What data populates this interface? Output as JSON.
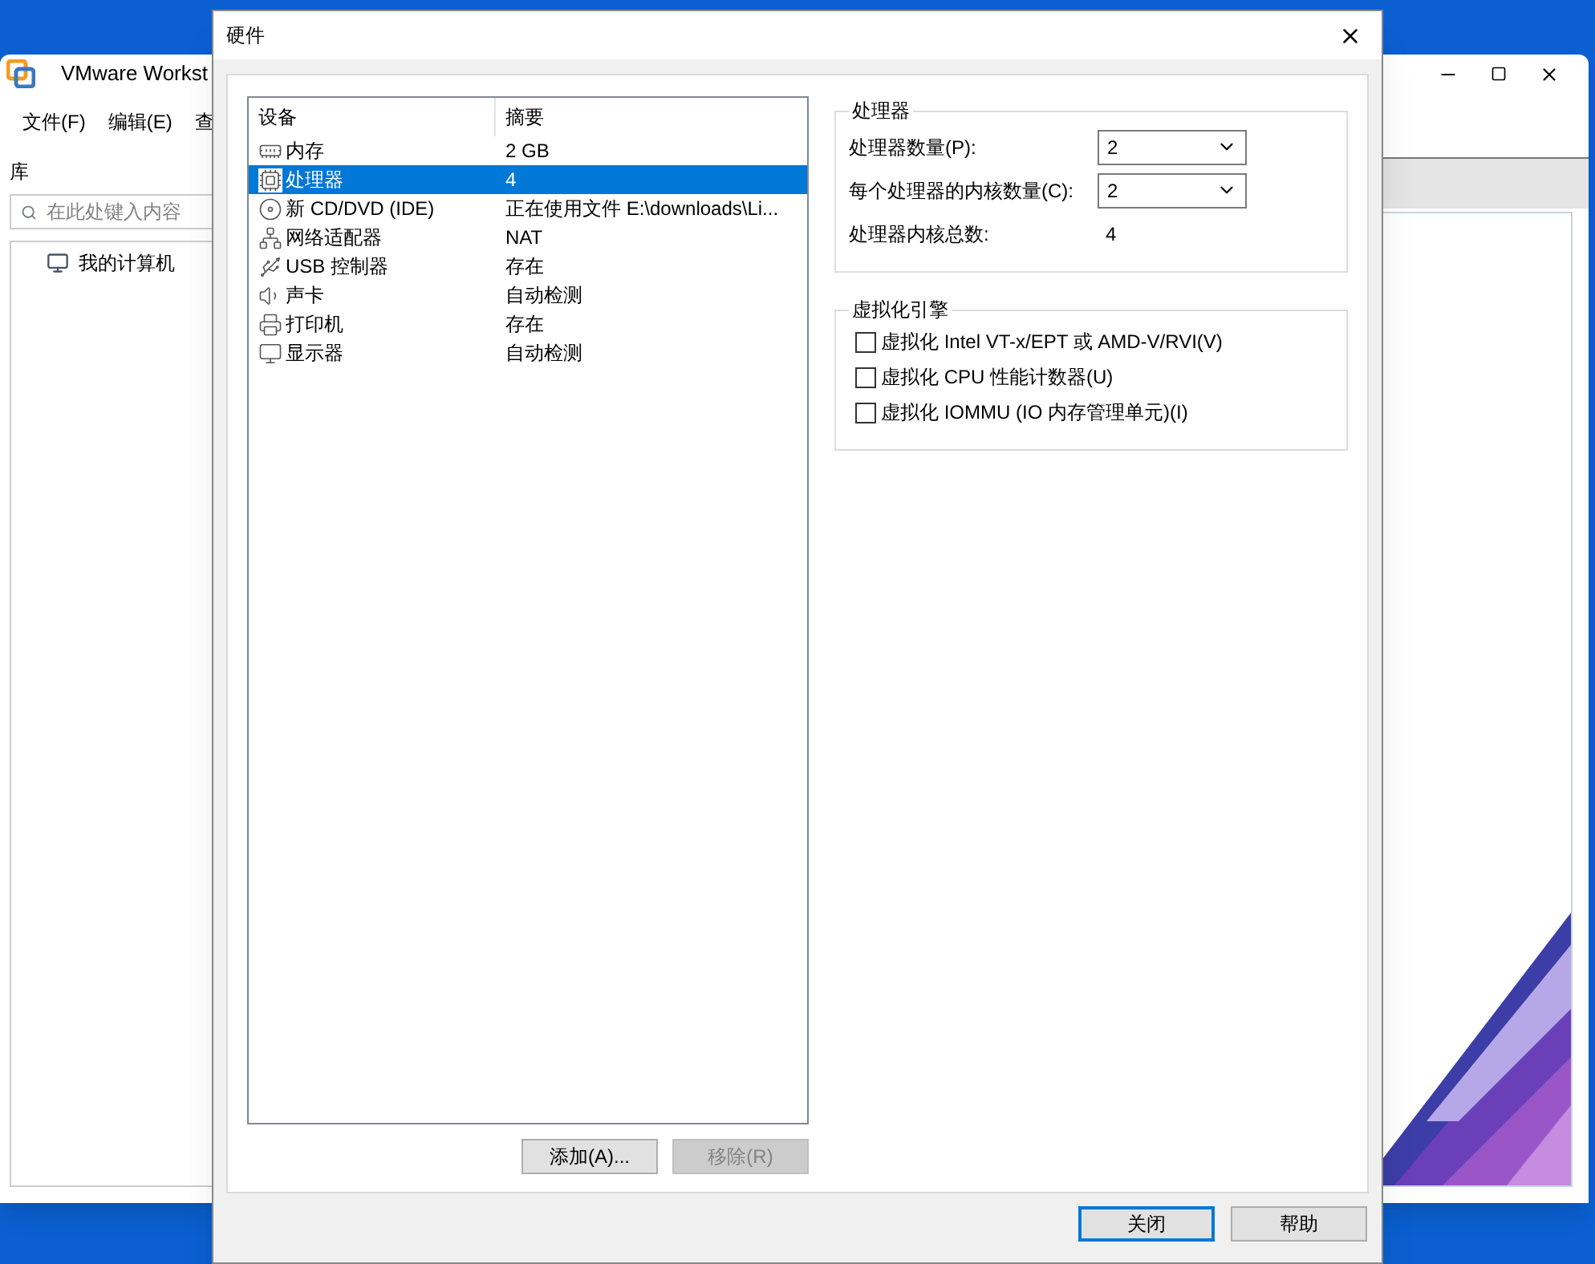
{
  "background_window": {
    "title": "VMware Workst",
    "menu": [
      "文件(F)",
      "编辑(E)",
      "查"
    ],
    "library_label": "库",
    "search": {
      "placeholder": "在此处键入内容"
    },
    "tree": [
      {
        "label": "我的计算机"
      }
    ]
  },
  "dialog": {
    "title": "硬件",
    "devices": {
      "columns": [
        "设备",
        "摘要"
      ],
      "rows": [
        {
          "kind": "memory",
          "device": "内存",
          "summary": "2 GB",
          "selected": false
        },
        {
          "kind": "processor",
          "device": "处理器",
          "summary": "4",
          "selected": true
        },
        {
          "kind": "disc",
          "device": "新 CD/DVD (IDE)",
          "summary": "正在使用文件 E:\\downloads\\Li...",
          "selected": false
        },
        {
          "kind": "network",
          "device": "网络适配器",
          "summary": "NAT",
          "selected": false
        },
        {
          "kind": "usb",
          "device": "USB 控制器",
          "summary": "存在",
          "selected": false
        },
        {
          "kind": "sound",
          "device": "声卡",
          "summary": "自动检测",
          "selected": false
        },
        {
          "kind": "printer",
          "device": "打印机",
          "summary": "存在",
          "selected": false
        },
        {
          "kind": "display",
          "device": "显示器",
          "summary": "自动检测",
          "selected": false
        }
      ]
    },
    "device_buttons": [
      {
        "label": "添加(A)...",
        "disabled": false
      },
      {
        "label": "移除(R)",
        "disabled": true
      }
    ],
    "processor_group": {
      "title": "处理器",
      "fields": [
        {
          "kind": "dropdown",
          "label": "处理器数量(P):",
          "value": "2"
        },
        {
          "kind": "dropdown",
          "label": "每个处理器的内核数量(C):",
          "value": "2"
        },
        {
          "kind": "readout",
          "label": "处理器内核总数:",
          "value": "4"
        }
      ]
    },
    "virtualization_group": {
      "title": "虚拟化引擎",
      "options": [
        {
          "label": "虚拟化 Intel VT-x/EPT 或 AMD-V/RVI(V)",
          "checked": false
        },
        {
          "label": "虚拟化 CPU 性能计数器(U)",
          "checked": false
        },
        {
          "label": "虚拟化 IOMMU (IO 内存管理单元)(I)",
          "checked": false
        }
      ]
    },
    "footer_buttons": [
      {
        "label": "关闭",
        "default": true
      },
      {
        "label": "帮助",
        "default": false
      }
    ]
  }
}
